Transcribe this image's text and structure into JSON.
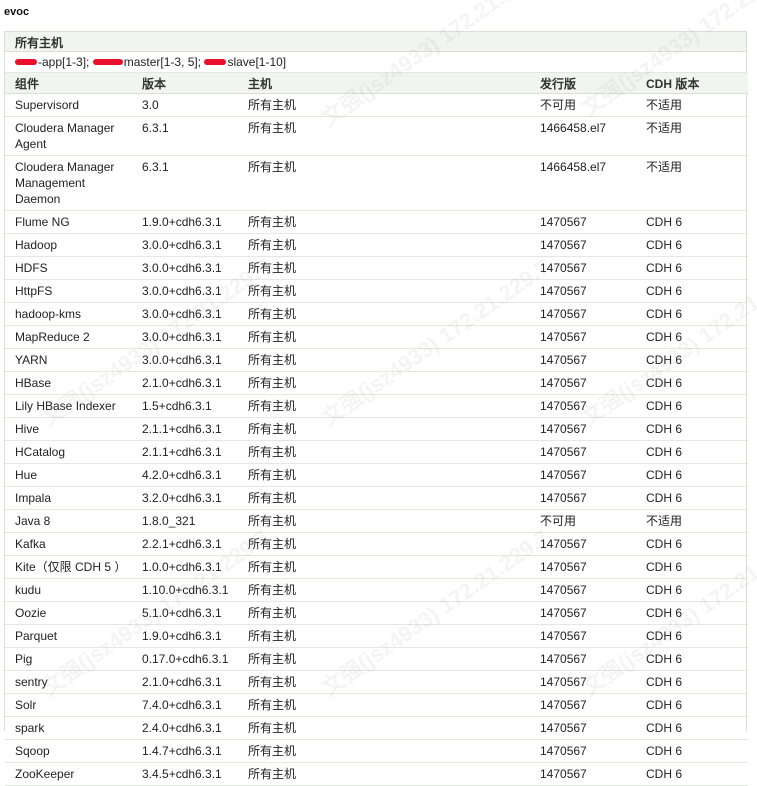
{
  "cluster": {
    "name": "evoc"
  },
  "panel": {
    "heading": "所有主机",
    "hosts": {
      "app": "-app[1-3];",
      "master": "master[1-3, 5];",
      "slave": "slave[1-10]"
    }
  },
  "table": {
    "headers": [
      "组件",
      "版本",
      "主机",
      "发行版",
      "CDH 版本"
    ],
    "rows": [
      [
        "Supervisord",
        "3.0",
        "所有主机",
        "不可用",
        "不适用"
      ],
      [
        "Cloudera Manager Agent",
        "6.3.1",
        "所有主机",
        "1466458.el7",
        "不适用"
      ],
      [
        "Cloudera Manager Management Daemon",
        "6.3.1",
        "所有主机",
        "1466458.el7",
        "不适用"
      ],
      [
        "Flume NG",
        "1.9.0+cdh6.3.1",
        "所有主机",
        "1470567",
        "CDH 6"
      ],
      [
        "Hadoop",
        "3.0.0+cdh6.3.1",
        "所有主机",
        "1470567",
        "CDH 6"
      ],
      [
        "HDFS",
        "3.0.0+cdh6.3.1",
        "所有主机",
        "1470567",
        "CDH 6"
      ],
      [
        "HttpFS",
        "3.0.0+cdh6.3.1",
        "所有主机",
        "1470567",
        "CDH 6"
      ],
      [
        "hadoop-kms",
        "3.0.0+cdh6.3.1",
        "所有主机",
        "1470567",
        "CDH 6"
      ],
      [
        "MapReduce 2",
        "3.0.0+cdh6.3.1",
        "所有主机",
        "1470567",
        "CDH 6"
      ],
      [
        "YARN",
        "3.0.0+cdh6.3.1",
        "所有主机",
        "1470567",
        "CDH 6"
      ],
      [
        "HBase",
        "2.1.0+cdh6.3.1",
        "所有主机",
        "1470567",
        "CDH 6"
      ],
      [
        "Lily HBase Indexer",
        "1.5+cdh6.3.1",
        "所有主机",
        "1470567",
        "CDH 6"
      ],
      [
        "Hive",
        "2.1.1+cdh6.3.1",
        "所有主机",
        "1470567",
        "CDH 6"
      ],
      [
        "HCatalog",
        "2.1.1+cdh6.3.1",
        "所有主机",
        "1470567",
        "CDH 6"
      ],
      [
        "Hue",
        "4.2.0+cdh6.3.1",
        "所有主机",
        "1470567",
        "CDH 6"
      ],
      [
        "Impala",
        "3.2.0+cdh6.3.1",
        "所有主机",
        "1470567",
        "CDH 6"
      ],
      [
        "Java 8",
        "1.8.0_321",
        "所有主机",
        "不可用",
        "不适用"
      ],
      [
        "Kafka",
        "2.2.1+cdh6.3.1",
        "所有主机",
        "1470567",
        "CDH 6"
      ],
      [
        "Kite（仅限 CDH 5 ）",
        "1.0.0+cdh6.3.1",
        "所有主机",
        "1470567",
        "CDH 6"
      ],
      [
        "kudu",
        "1.10.0+cdh6.3.1",
        "所有主机",
        "1470567",
        "CDH 6"
      ],
      [
        "Oozie",
        "5.1.0+cdh6.3.1",
        "所有主机",
        "1470567",
        "CDH 6"
      ],
      [
        "Parquet",
        "1.9.0+cdh6.3.1",
        "所有主机",
        "1470567",
        "CDH 6"
      ],
      [
        "Pig",
        "0.17.0+cdh6.3.1",
        "所有主机",
        "1470567",
        "CDH 6"
      ],
      [
        "sentry",
        "2.1.0+cdh6.3.1",
        "所有主机",
        "1470567",
        "CDH 6"
      ],
      [
        "Solr",
        "7.4.0+cdh6.3.1",
        "所有主机",
        "1470567",
        "CDH 6"
      ],
      [
        "spark",
        "2.4.0+cdh6.3.1",
        "所有主机",
        "1470567",
        "CDH 6"
      ],
      [
        "Sqoop",
        "1.4.7+cdh6.3.1",
        "所有主机",
        "1470567",
        "CDH 6"
      ],
      [
        "ZooKeeper",
        "3.4.5+cdh6.3.1",
        "所有主机",
        "1470567",
        "CDH 6"
      ]
    ]
  },
  "watermark": {
    "text": "文强(jsz4933) 172.21.229.7"
  },
  "colors": {
    "redaction": "#e8102a",
    "header_bg": "#f2f5ef",
    "border": "#d9dfd5"
  }
}
